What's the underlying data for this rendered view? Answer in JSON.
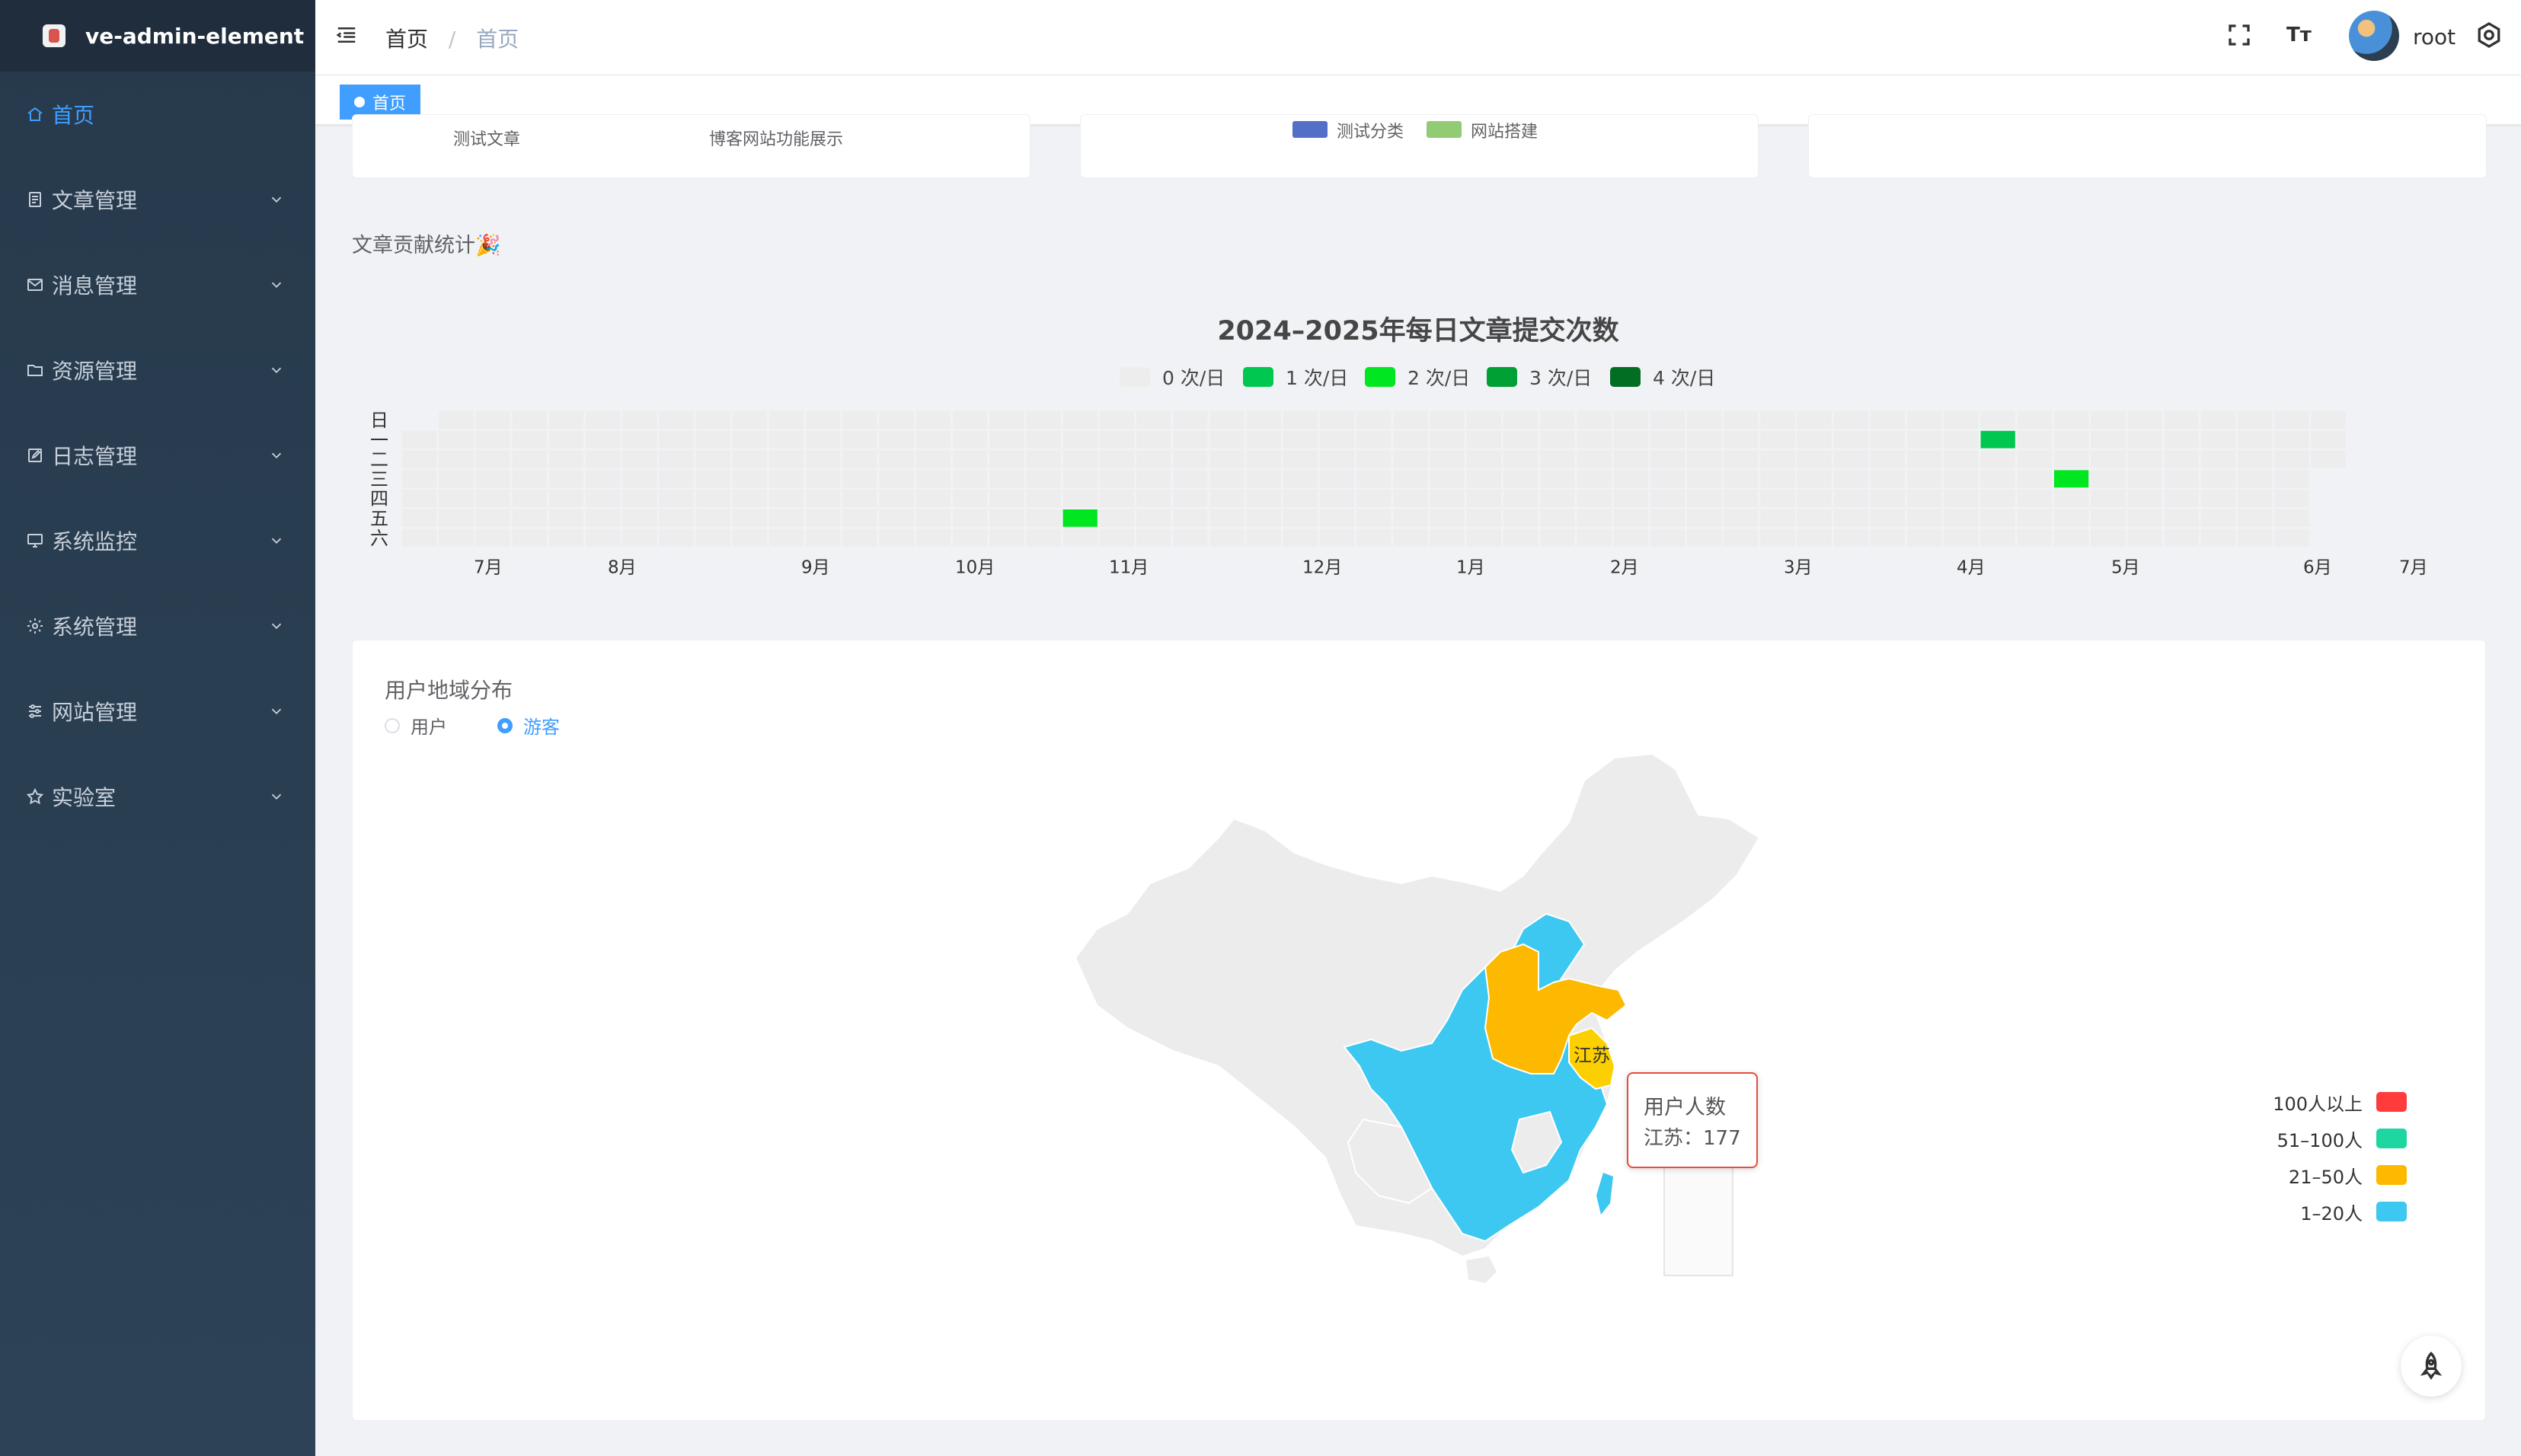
{
  "app": {
    "name": "ve-admin-element"
  },
  "sidebar": {
    "items": [
      {
        "label": "首页",
        "icon": "home-icon",
        "active": true
      },
      {
        "label": "文章管理",
        "icon": "document-icon"
      },
      {
        "label": "消息管理",
        "icon": "message-icon"
      },
      {
        "label": "资源管理",
        "icon": "folder-icon"
      },
      {
        "label": "日志管理",
        "icon": "edit-log-icon"
      },
      {
        "label": "系统监控",
        "icon": "monitor-icon"
      },
      {
        "label": "系统管理",
        "icon": "gear-icon"
      },
      {
        "label": "网站管理",
        "icon": "sliders-icon"
      },
      {
        "label": "实验室",
        "icon": "star-icon"
      }
    ]
  },
  "header": {
    "breadcrumb": [
      "首页",
      "首页"
    ],
    "separator": "/",
    "username": "root",
    "font_size_icon_label": "Tт"
  },
  "tags": {
    "active": "首页"
  },
  "top_cards": {
    "card1": {
      "left_text": "测试文章",
      "right_text": "博客网站功能展示"
    },
    "card2": {
      "legend": [
        {
          "name": "测试分类",
          "color": "#5470c6"
        },
        {
          "name": "网站搭建",
          "color": "#91cc75"
        }
      ]
    }
  },
  "contribution": {
    "section_title": "文章贡献统计🎉",
    "chart_data": {
      "type": "heatmap",
      "title": "2024–2025年每日文章提交次数",
      "legend": [
        {
          "label": "0 次/日",
          "color": "#ededed"
        },
        {
          "label": "1 次/日",
          "color": "#00c750"
        },
        {
          "label": "2 次/日",
          "color": "#00e621"
        },
        {
          "label": "3 次/日",
          "color": "#01a035"
        },
        {
          "label": "4 次/日",
          "color": "#016e24"
        }
      ],
      "weekdays": [
        "日",
        "一",
        "二",
        "三",
        "四",
        "五",
        "六"
      ],
      "months": [
        "7月",
        "8月",
        "9月",
        "10月",
        "11月",
        "12月",
        "1月",
        "2月",
        "3月",
        "4月",
        "5月",
        "6月",
        "7月"
      ],
      "weeks": 53,
      "highlights": [
        {
          "week": 18,
          "day": 5,
          "count": 2
        },
        {
          "week": 43,
          "day": 1,
          "count": 1
        },
        {
          "week": 45,
          "day": 3,
          "count": 2
        }
      ]
    }
  },
  "map": {
    "title": "用户地域分布",
    "radio": [
      {
        "label": "用户",
        "checked": false
      },
      {
        "label": "游客",
        "checked": true
      }
    ],
    "highlight_label": "江苏",
    "tooltip": {
      "title": "用户人数",
      "line": "江苏：177"
    },
    "visual_map": [
      {
        "label": "100人以上",
        "color": "#ff3b3b"
      },
      {
        "label": "51–100人",
        "color": "#1dd6a0"
      },
      {
        "label": "21–50人",
        "color": "#fcb900"
      },
      {
        "label": "1–20人",
        "color": "#3cc8f0"
      }
    ]
  }
}
